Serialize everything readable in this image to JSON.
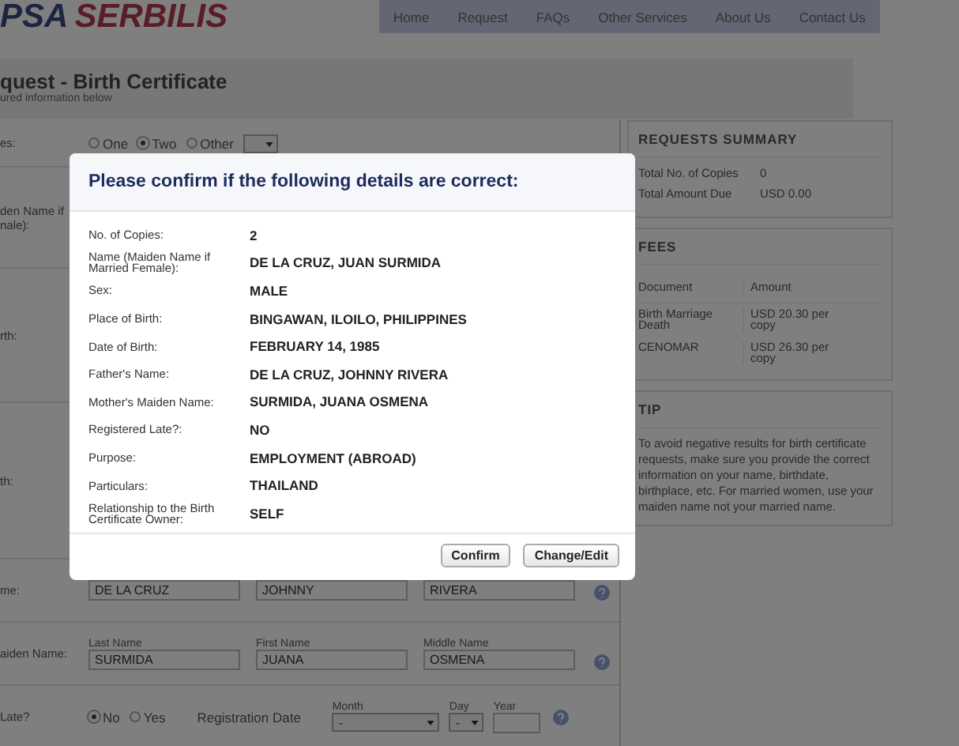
{
  "header": {
    "logo": {
      "prefix": "PSA",
      "name": "SERBILIS"
    },
    "nav": [
      {
        "label": "Home"
      },
      {
        "label": "Request"
      },
      {
        "label": "FAQs"
      },
      {
        "label": "Other Services"
      },
      {
        "label": "About Us"
      },
      {
        "label": "Contact Us"
      }
    ]
  },
  "page": {
    "title": "quest - Birth Certificate",
    "subtitle": "ured information below"
  },
  "form": {
    "copies": {
      "label": "es:",
      "options": [
        {
          "label": "One",
          "selected": false
        },
        {
          "label": "Two",
          "selected": true
        },
        {
          "label": "Other",
          "selected": false
        }
      ]
    },
    "partial_labels": [
      [
        "den Name if",
        "nale):"
      ],
      [
        "rth:"
      ],
      [
        "th:"
      ]
    ],
    "father": {
      "label": "me:",
      "fields": [
        {
          "value": "DE LA CRUZ"
        },
        {
          "value": "JOHNNY"
        },
        {
          "value": "RIVERA"
        }
      ]
    },
    "mother": {
      "label": "aiden Name:",
      "fields": [
        {
          "caption": "Last Name",
          "value": "SURMIDA"
        },
        {
          "caption": "First Name",
          "value": "JUANA"
        },
        {
          "caption": "Middle Name",
          "value": "OSMENA"
        }
      ]
    },
    "registered_late": {
      "label": "Late?",
      "options": [
        {
          "label": "No",
          "selected": true
        },
        {
          "label": "Yes",
          "selected": false
        }
      ],
      "date_label": "Registration Date",
      "month": {
        "caption": "Month",
        "value": "-"
      },
      "day": {
        "caption": "Day",
        "value": "-"
      },
      "year": {
        "caption": "Year"
      }
    }
  },
  "sidebar": {
    "summary": {
      "title": "REQUESTS SUMMARY",
      "rows": [
        {
          "label": "Total No. of Copies",
          "value": "0"
        },
        {
          "label": "Total Amount Due",
          "value": "USD 0.00"
        }
      ]
    },
    "fees": {
      "title": "FEES",
      "columns": [
        "Document",
        "Amount"
      ],
      "rows": [
        {
          "document": "Birth Marriage Death",
          "amount": "USD 20.30 per copy"
        },
        {
          "document": "CENOMAR",
          "amount": "USD 26.30 per copy"
        }
      ]
    },
    "tip": {
      "title": "TIP",
      "text": "To avoid negative results for birth certificate requests, make sure you provide the correct information on your name, birthdate, birthplace, etc. For married women, use your maiden name not your married name."
    }
  },
  "modal": {
    "title": "Please confirm if the following details are correct:",
    "rows": [
      {
        "label": "No. of Copies:",
        "value": "2"
      },
      {
        "label": "Name (Maiden Name if Married Female):",
        "value": "DE LA CRUZ, JUAN SURMIDA"
      },
      {
        "label": "Sex:",
        "value": "MALE"
      },
      {
        "label": "Place of Birth:",
        "value": "BINGAWAN, ILOILO, PHILIPPINES"
      },
      {
        "label": "Date of Birth:",
        "value": "FEBRUARY 14, 1985"
      },
      {
        "label": "Father's Name:",
        "value": "DE LA CRUZ, JOHNNY RIVERA"
      },
      {
        "label": "Mother's Maiden Name:",
        "value": "SURMIDA, JUANA OSMENA"
      },
      {
        "label": "Registered Late?:",
        "value": "NO"
      },
      {
        "label": "Purpose:",
        "value": "EMPLOYMENT (ABROAD)"
      },
      {
        "label": "Particulars:",
        "value": "THAILAND"
      },
      {
        "label": "Relationship to the Birth Certificate Owner:",
        "value": "SELF"
      }
    ],
    "buttons": [
      {
        "label": "Confirm"
      },
      {
        "label": "Change/Edit"
      }
    ]
  }
}
